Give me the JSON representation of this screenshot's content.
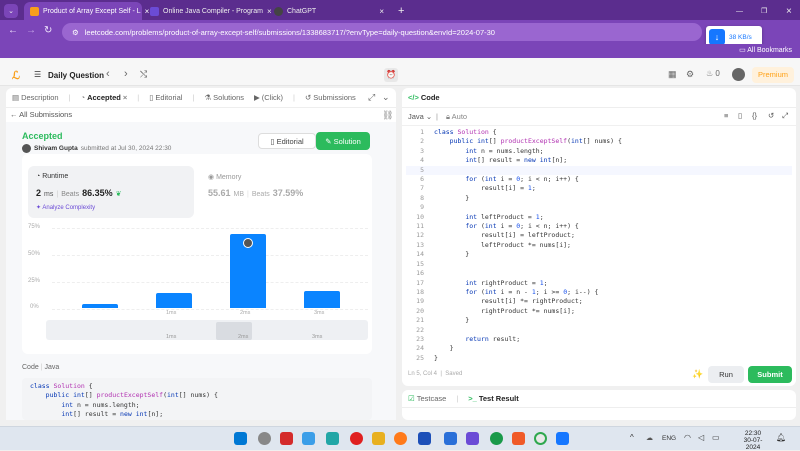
{
  "browser": {
    "tabs": [
      {
        "title": "Product of Array Except Self - L",
        "active": true,
        "color": "#f89f1b"
      },
      {
        "title": "Online Java Compiler - Program",
        "active": false,
        "color": "#6b4bd6"
      },
      {
        "title": "ChatGPT",
        "active": false,
        "color": "#444444"
      }
    ],
    "url": "leetcode.com/problems/product-of-array-except-self/submissions/1338683717/?envType=daily-question&envId=2024-07-30",
    "bookmarks_label": "All Bookmarks",
    "speed_ext": "38 KB/s"
  },
  "lc_header": {
    "title": "Daily Question",
    "premium": "Premium",
    "streak": "0"
  },
  "left": {
    "tabs": [
      "Description",
      "Accepted",
      "Editorial",
      "Solutions",
      "(Click)",
      "Submissions"
    ],
    "all_submissions": "All Submissions",
    "status": "Accepted",
    "author": "Shivam Gupta",
    "submitted_at": "submitted at Jul 30, 2024 22:30",
    "editorial_btn": "Editorial",
    "solution_btn": "Solution",
    "runtime": {
      "label": "Runtime",
      "value": "2",
      "unit": "ms",
      "beats_label": "Beats",
      "beats": "86.35%"
    },
    "memory": {
      "label": "Memory",
      "value": "55.61",
      "unit": "MB",
      "beats_label": "Beats",
      "beats": "37.59%"
    },
    "analyze": "Analyze Complexity",
    "chart_data": {
      "type": "bar",
      "categories": [
        "",
        "",
        "1ms",
        "2ms",
        "3ms"
      ],
      "values": [
        4,
        17,
        82,
        19
      ],
      "ylabels": [
        "75%",
        "50%",
        "25%",
        "0%"
      ],
      "ylim": [
        0,
        75
      ],
      "x_ticks": [
        "1ms",
        "2ms",
        "3ms"
      ]
    },
    "code_lang_label": "Code",
    "code_lang": "Java",
    "code_preview": [
      "class Solution {",
      "    public int[] productExceptSelf(int[] nums) {",
      "        int n = nums.length;",
      "        int[] result = new int[n];"
    ]
  },
  "right": {
    "tab": "Code",
    "language": "Java",
    "auto": "Auto",
    "code": [
      "class Solution {",
      "    public int[] productExceptSelf(int[] nums) {",
      "        int n = nums.length;",
      "        int[] result = new int[n];",
      "",
      "        for (int i = 0; i < n; i++) {",
      "            result[i] = 1;",
      "        }",
      "",
      "        int leftProduct = 1;",
      "        for (int i = 0; i < n; i++) {",
      "            result[i] = leftProduct;",
      "            leftProduct *= nums[i];",
      "        }",
      "",
      "",
      "        int rightProduct = 1;",
      "        for (int i = n - 1; i >= 0; i--) {",
      "            result[i] *= rightProduct;",
      "            rightProduct *= nums[i];",
      "        }",
      "",
      "        return result;",
      "    }",
      "}"
    ],
    "cursor": "Ln 5, Col 4",
    "saved": "Saved",
    "run": "Run",
    "submit": "Submit"
  },
  "test": {
    "testcase": "Testcase",
    "result": "Test Result"
  },
  "taskbar": {
    "lang": "ENG",
    "time": "22:30",
    "date": "30-07-2024"
  },
  "colors": {
    "accent_green": "#2cbb5d",
    "bar_blue": "#0a84ff",
    "premium": "#ffa116"
  }
}
